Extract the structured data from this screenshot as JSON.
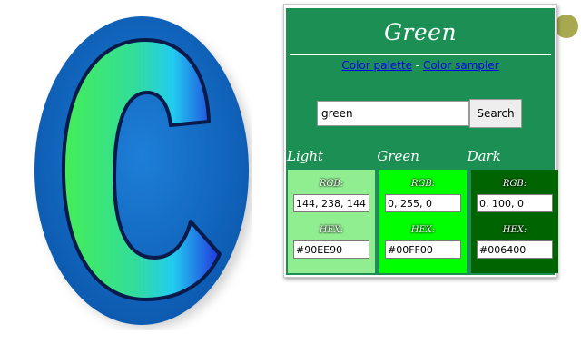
{
  "title": "Green",
  "links": {
    "palette": "Color palette",
    "separator": " - ",
    "sampler": "Color sampler"
  },
  "search": {
    "value": "green",
    "button_label": "Search"
  },
  "shades": [
    {
      "heading": "Light",
      "rgb_label": "RGB:",
      "rgb": "144, 238, 144",
      "hex_label": "HEX:",
      "hex": "#90EE90",
      "color": "#90ee90"
    },
    {
      "heading": "Green",
      "rgb_label": "RGB:",
      "rgb": "0, 255, 0",
      "hex_label": "HEX:",
      "hex": "#00FF00",
      "color": "#00ff00"
    },
    {
      "heading": "Dark",
      "rgb_label": "RGB:",
      "rgb": "0, 100, 0",
      "hex_label": "HEX:",
      "hex": "#006400",
      "color": "#006400"
    }
  ],
  "colors": {
    "widget_bg": "#1c8f55",
    "link": "#0000ee",
    "logo_oval": "#0f62b8"
  },
  "icons": {
    "logo": "letter-c-logo"
  }
}
